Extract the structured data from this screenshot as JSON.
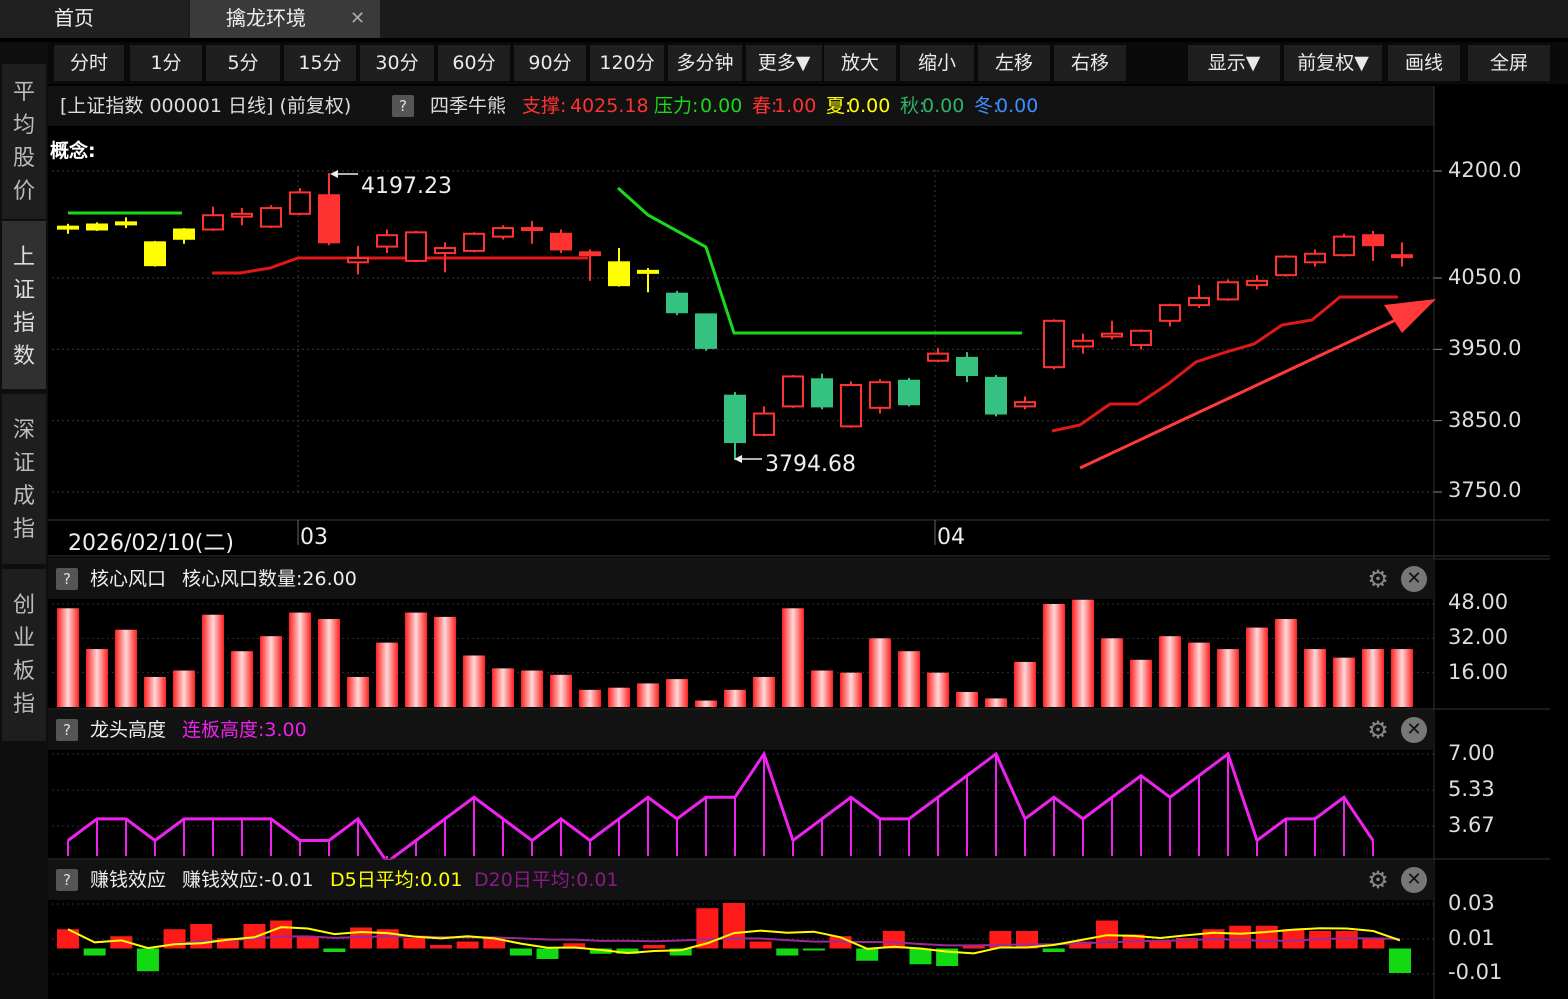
{
  "tabs": {
    "home": "首页",
    "active": "擒龙环境",
    "close": "✕"
  },
  "sidebar": [
    {
      "label": "平\n均\n股\n价"
    },
    {
      "label": "上\n证\n指\n数"
    },
    {
      "label": "深\n证\n成\n指"
    },
    {
      "label": "创\n业\n板\n指"
    }
  ],
  "toolbar": [
    "分时",
    "1分",
    "5分",
    "15分",
    "30分",
    "60分",
    "90分",
    "120分",
    "多分钟",
    "更多▼",
    "放大",
    "缩小",
    "左移",
    "右移",
    "显示▼",
    "前复权▼",
    "画线",
    "全屏"
  ],
  "info": {
    "title": "[上证指数 000001 日线]  (前复权)",
    "q": "?",
    "name": "四季牛熊",
    "support_label": "支撑:",
    "support": "4025.18",
    "pressure_label": "压力:",
    "pressure": "0.00",
    "spring_label": "春:",
    "spring": "1.00",
    "summer_label": "夏:",
    "summer": "0.00",
    "autumn_label": "秋:",
    "autumn": "0.00",
    "winter_label": "冬:",
    "winter": "0.00"
  },
  "concept_label": "概念:",
  "price_axis": [
    "4200.0",
    "4050.0",
    "3950.0",
    "3850.0",
    "3750.0"
  ],
  "annotations": {
    "high": "4197.23",
    "low": "3794.68"
  },
  "dates": {
    "current": "2026/02/10(二)",
    "m1": "03",
    "m2": "04"
  },
  "colors": {
    "up": "#ff3232",
    "down": "#35c280",
    "yellow": "#ffff00",
    "green_line": "#1ad81a",
    "magenta": "#ee22ee"
  },
  "panels": {
    "core": {
      "q": "?",
      "name": "核心风口",
      "value_label": "核心风口数量:26.00",
      "axis": [
        "48.00",
        "32.00",
        "16.00"
      ]
    },
    "dragon": {
      "q": "?",
      "name": "龙头高度",
      "value_label": "连板高度:3.00",
      "axis": [
        "7.00",
        "5.33",
        "3.67"
      ]
    },
    "money": {
      "q": "?",
      "name": "赚钱效应",
      "value_label": "赚钱效应:-0.01",
      "d5": "D5日平均:0.01",
      "d20": "D20日平均:0.01",
      "axis": [
        "0.03",
        "0.01",
        "-0.01"
      ]
    }
  },
  "chart_data": {
    "type": "candlestick",
    "candles": [
      {
        "o": 4120,
        "c": 4122,
        "h": 4126,
        "l": 4112,
        "col": "y"
      },
      {
        "o": 4118,
        "c": 4125,
        "h": 4128,
        "l": 4116,
        "col": "y"
      },
      {
        "o": 4128,
        "c": 4126,
        "h": 4135,
        "l": 4120,
        "col": "y"
      },
      {
        "o": 4100,
        "c": 4068,
        "h": 4102,
        "l": 4066,
        "col": "y"
      },
      {
        "o": 4118,
        "c": 4105,
        "h": 4120,
        "l": 4098,
        "col": "y"
      },
      {
        "o": 4118,
        "c": 4138,
        "h": 4150,
        "l": 4116,
        "col": "r"
      },
      {
        "o": 4136,
        "c": 4140,
        "h": 4148,
        "l": 4124,
        "col": "r"
      },
      {
        "o": 4122,
        "c": 4148,
        "h": 4152,
        "l": 4120,
        "col": "r"
      },
      {
        "o": 4140,
        "c": 4170,
        "h": 4176,
        "l": 4138,
        "col": "r"
      },
      {
        "o": 4166,
        "c": 4100,
        "h": 4197,
        "l": 4096,
        "col": "r"
      },
      {
        "o": 4072,
        "c": 4078,
        "h": 4095,
        "l": 4055,
        "col": "r"
      },
      {
        "o": 4094,
        "c": 4110,
        "h": 4118,
        "l": 4085,
        "col": "r"
      },
      {
        "o": 4074,
        "c": 4114,
        "h": 4116,
        "l": 4072,
        "col": "r"
      },
      {
        "o": 4085,
        "c": 4092,
        "h": 4100,
        "l": 4058,
        "col": "r"
      },
      {
        "o": 4088,
        "c": 4112,
        "h": 4114,
        "l": 4086,
        "col": "r"
      },
      {
        "o": 4108,
        "c": 4120,
        "h": 4124,
        "l": 4104,
        "col": "r"
      },
      {
        "o": 4120,
        "c": 4118,
        "h": 4130,
        "l": 4098,
        "col": "r"
      },
      {
        "o": 4112,
        "c": 4090,
        "h": 4118,
        "l": 4085,
        "col": "r"
      },
      {
        "o": 4086,
        "c": 4082,
        "h": 4090,
        "l": 4046,
        "col": "r"
      },
      {
        "o": 4072,
        "c": 4040,
        "h": 4092,
        "l": 4038,
        "col": "y"
      },
      {
        "o": 4058,
        "c": 4060,
        "h": 4064,
        "l": 4030,
        "col": "y"
      },
      {
        "o": 4028,
        "c": 4002,
        "h": 4032,
        "l": 3998,
        "col": "g"
      },
      {
        "o": 3999,
        "c": 3952,
        "h": 4000,
        "l": 3948,
        "col": "g"
      },
      {
        "o": 3885,
        "c": 3820,
        "h": 3890,
        "l": 3795,
        "col": "g"
      },
      {
        "o": 3830,
        "c": 3860,
        "h": 3870,
        "l": 3828,
        "col": "r"
      },
      {
        "o": 3870,
        "c": 3912,
        "h": 3914,
        "l": 3868,
        "col": "r"
      },
      {
        "o": 3908,
        "c": 3870,
        "h": 3916,
        "l": 3866,
        "col": "g"
      },
      {
        "o": 3842,
        "c": 3900,
        "h": 3905,
        "l": 3840,
        "col": "r"
      },
      {
        "o": 3868,
        "c": 3904,
        "h": 3908,
        "l": 3860,
        "col": "r"
      },
      {
        "o": 3906,
        "c": 3873,
        "h": 3910,
        "l": 3870,
        "col": "g"
      },
      {
        "o": 3934,
        "c": 3944,
        "h": 3952,
        "l": 3932,
        "col": "r"
      },
      {
        "o": 3938,
        "c": 3914,
        "h": 3946,
        "l": 3904,
        "col": "g"
      },
      {
        "o": 3910,
        "c": 3860,
        "h": 3914,
        "l": 3856,
        "col": "g"
      },
      {
        "o": 3870,
        "c": 3876,
        "h": 3884,
        "l": 3866,
        "col": "r"
      },
      {
        "o": 3925,
        "c": 3990,
        "h": 3992,
        "l": 3922,
        "col": "r"
      },
      {
        "o": 3954,
        "c": 3962,
        "h": 3972,
        "l": 3944,
        "col": "r"
      },
      {
        "o": 3968,
        "c": 3972,
        "h": 3990,
        "l": 3964,
        "col": "r"
      },
      {
        "o": 3956,
        "c": 3976,
        "h": 3978,
        "l": 3950,
        "col": "r"
      },
      {
        "o": 3990,
        "c": 4012,
        "h": 4014,
        "l": 3982,
        "col": "r"
      },
      {
        "o": 4012,
        "c": 4022,
        "h": 4040,
        "l": 4008,
        "col": "r"
      },
      {
        "o": 4020,
        "c": 4044,
        "h": 4048,
        "l": 4018,
        "col": "r"
      },
      {
        "o": 4040,
        "c": 4046,
        "h": 4054,
        "l": 4034,
        "col": "r"
      },
      {
        "o": 4054,
        "c": 4080,
        "h": 4082,
        "l": 4052,
        "col": "r"
      },
      {
        "o": 4072,
        "c": 4084,
        "h": 4090,
        "l": 4066,
        "col": "r"
      },
      {
        "o": 4082,
        "c": 4108,
        "h": 4112,
        "l": 4080,
        "col": "r"
      },
      {
        "o": 4110,
        "c": 4096,
        "h": 4116,
        "l": 4074,
        "col": "r"
      },
      {
        "o": 4080,
        "c": 4082,
        "h": 4100,
        "l": 4066,
        "col": "r"
      }
    ],
    "core_values": [
      46,
      27,
      36,
      14,
      17,
      43,
      26,
      33,
      44,
      41,
      14,
      30,
      44,
      42,
      24,
      18,
      17,
      15,
      8,
      9,
      11,
      13,
      3,
      8,
      14,
      46,
      17,
      16,
      32,
      26,
      16,
      7,
      4,
      21,
      48,
      50,
      32,
      22,
      33,
      30,
      27,
      37,
      41,
      27,
      23,
      27,
      27
    ],
    "dragon_values": [
      3,
      4,
      4,
      3,
      4,
      4,
      4,
      4,
      3,
      3,
      4,
      2,
      3,
      4,
      5,
      4,
      3,
      4,
      3,
      4,
      5,
      4,
      5,
      5,
      7,
      3,
      4,
      5,
      4,
      4,
      5,
      6,
      7,
      4,
      5,
      4,
      5,
      6,
      5,
      6,
      7,
      3,
      4,
      4,
      5,
      3
    ],
    "money_values": [
      0.011,
      -0.004,
      0.007,
      -0.013,
      0.011,
      0.014,
      0.006,
      0.014,
      0.016,
      0.007,
      -0.002,
      0.012,
      0.011,
      0.006,
      0.002,
      0.004,
      0.006,
      -0.004,
      -0.006,
      0.003,
      -0.003,
      -0.003,
      0.002,
      -0.004,
      0.023,
      0.026,
      0.004,
      -0.004,
      -0.001,
      0.007,
      -0.007,
      0.01,
      -0.009,
      -0.01,
      0.002,
      0.01,
      0.01,
      -0.002,
      0.004,
      0.016,
      0.008,
      0.004,
      0.006,
      0.011,
      0.013,
      0.013,
      0.011,
      0.01,
      0.01,
      0.006,
      -0.014
    ]
  }
}
